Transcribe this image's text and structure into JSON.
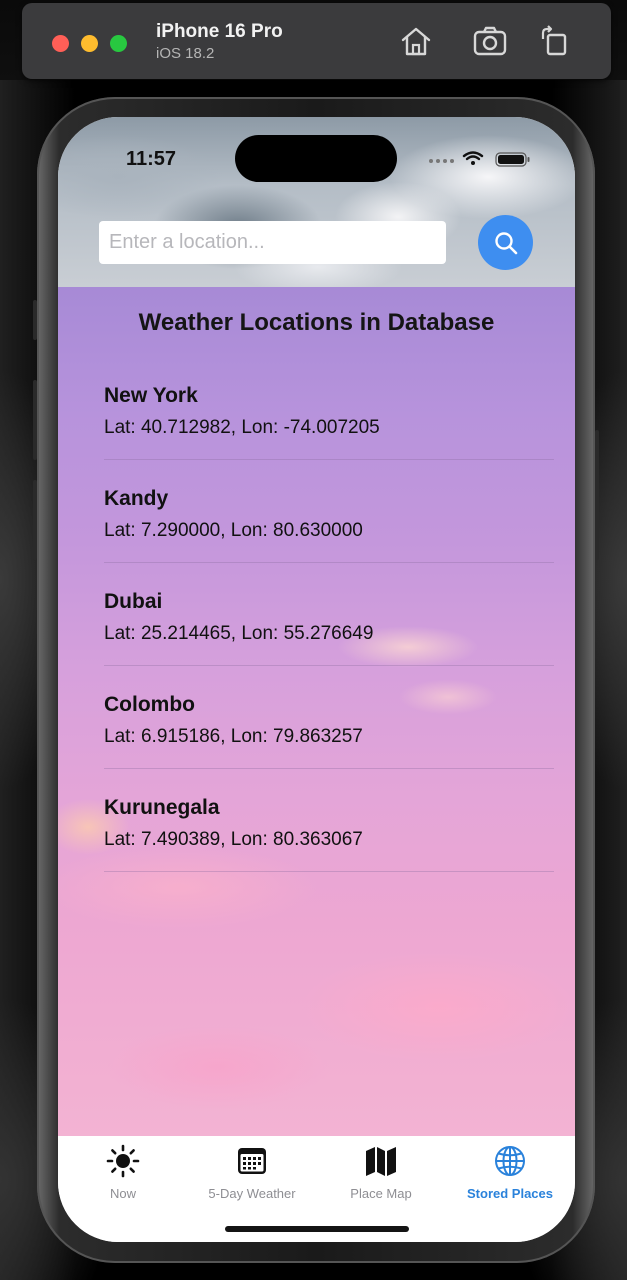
{
  "simulator": {
    "device_name": "iPhone 16 Pro",
    "os_version": "iOS 18.2",
    "toolbar_icons": [
      "home-icon",
      "screenshot-icon",
      "rotate-icon"
    ]
  },
  "status_bar": {
    "time": "11:57"
  },
  "search": {
    "placeholder": "Enter a location...",
    "value": "",
    "button_icon": "magnifier-icon"
  },
  "list": {
    "title": "Weather Locations in Database",
    "items": [
      {
        "name": "New York",
        "coords": "Lat: 40.712982, Lon: -74.007205"
      },
      {
        "name": "Kandy",
        "coords": "Lat: 7.290000, Lon: 80.630000"
      },
      {
        "name": "Dubai",
        "coords": "Lat: 25.214465, Lon: 55.276649"
      },
      {
        "name": "Colombo",
        "coords": "Lat: 6.915186, Lon: 79.863257"
      },
      {
        "name": "Kurunegala",
        "coords": "Lat: 7.490389, Lon: 80.363067"
      }
    ]
  },
  "tabs": [
    {
      "label": "Now",
      "icon": "sun-icon",
      "active": false
    },
    {
      "label": "5-Day Weather",
      "icon": "calendar-icon",
      "active": false
    },
    {
      "label": "Place Map",
      "icon": "map-icon",
      "active": false
    },
    {
      "label": "Stored Places",
      "icon": "globe-icon",
      "active": true
    }
  ],
  "colors": {
    "accent": "#2a82db",
    "search_button": "#3e8ef0",
    "inactive_tab": "#8e8e93"
  }
}
